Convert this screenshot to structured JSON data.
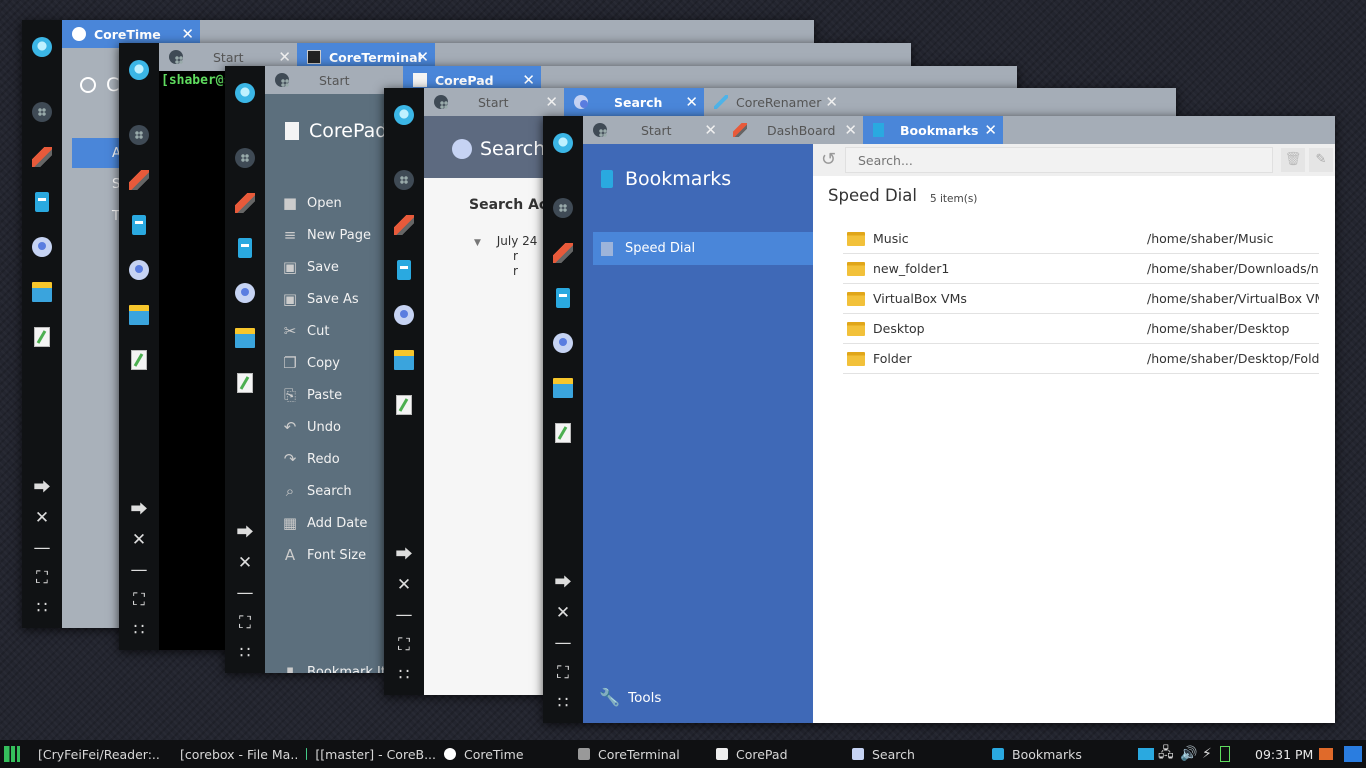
{
  "colors": {
    "accent": "#4a86d9",
    "bookmarks_sidebar": "#3f69b7",
    "corepad_sidebar": "#5c6f7d",
    "dock": "#101214"
  },
  "coretime": {
    "tab": "CoreTime",
    "title": "Co",
    "menu": [
      "A",
      "S",
      "T"
    ]
  },
  "coreterminal": {
    "tabs": [
      "Start",
      "CoreTerminal"
    ],
    "prompt": "[shaber@sl"
  },
  "corepad": {
    "tabs": [
      "Start",
      "CorePad"
    ],
    "title": "CorePad",
    "menu": [
      {
        "label": "Open",
        "icon": "folder-icon"
      },
      {
        "label": "New Page",
        "icon": "new-page-icon"
      },
      {
        "label": "Save",
        "icon": "save-icon"
      },
      {
        "label": "Save As",
        "icon": "save-as-icon"
      },
      {
        "label": "Cut",
        "icon": "cut-icon"
      },
      {
        "label": "Copy",
        "icon": "copy-icon"
      },
      {
        "label": "Paste",
        "icon": "paste-icon"
      },
      {
        "label": "Undo",
        "icon": "undo-icon"
      },
      {
        "label": "Redo",
        "icon": "redo-icon"
      },
      {
        "label": "Search",
        "icon": "search-icon"
      },
      {
        "label": "Add Date",
        "icon": "calendar-icon"
      },
      {
        "label": "Font Size",
        "icon": "font-size-icon"
      }
    ],
    "bookmark": "Bookmark It"
  },
  "search": {
    "tabs": [
      "Start",
      "Search",
      "CoreRenamer"
    ],
    "title": "Search",
    "activity": "Search Acti",
    "date": "July 24",
    "r1": "r",
    "r2": "r"
  },
  "bookmarks": {
    "tabs": [
      "Start",
      "DashBoard",
      "Bookmarks"
    ],
    "title": "Bookmarks",
    "section": "Speed Dial",
    "tools": "Tools",
    "search_placeholder": "Search...",
    "heading": "Speed Dial",
    "count": "5 item(s)",
    "items": [
      {
        "name": "Music",
        "path": "/home/shaber/Music"
      },
      {
        "name": "new_folder1",
        "path": "/home/shaber/Downloads/new_"
      },
      {
        "name": "VirtualBox VMs",
        "path": "/home/shaber/VirtualBox VMs"
      },
      {
        "name": "Desktop",
        "path": "/home/shaber/Desktop"
      },
      {
        "name": "Folder",
        "path": "/home/shaber/Desktop/Folder"
      }
    ]
  },
  "taskbar": {
    "items": [
      "[CryFeiFei/Reader:...",
      "[corebox - File Ma...",
      "[[master] - CoreB...",
      "CoreTime",
      "CoreTerminal",
      "CorePad",
      "Search",
      "Bookmarks"
    ],
    "clock": "09:31 PM"
  }
}
